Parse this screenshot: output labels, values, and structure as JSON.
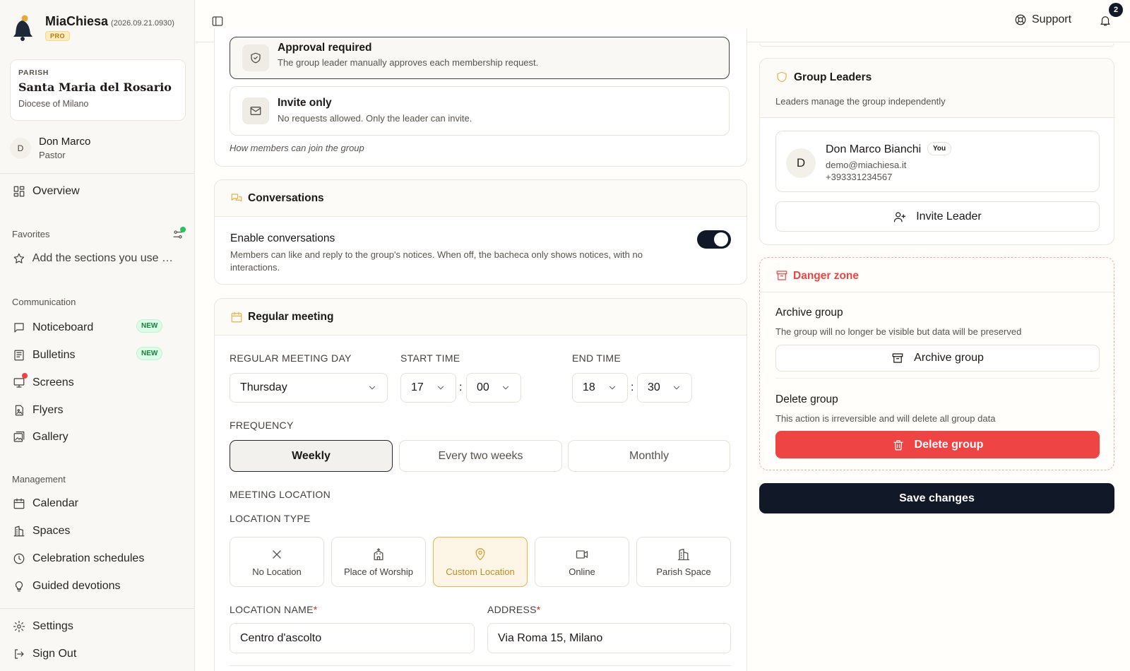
{
  "app": {
    "name": "MiaChiesa",
    "version": "(2026.09.21.0930)",
    "plan": "PRO"
  },
  "parish": {
    "label": "PARISH",
    "name": "Santa Maria del Rosario",
    "diocese": "Diocese of Milano"
  },
  "user": {
    "initial": "D",
    "name": "Don Marco",
    "role": "Pastor"
  },
  "sidebar": {
    "overview": "Overview",
    "favorites_label": "Favorites",
    "favorites_hint": "Add the sections you use most",
    "communication_label": "Communication",
    "communication": [
      {
        "label": "Noticeboard",
        "badge": "NEW"
      },
      {
        "label": "Bulletins",
        "badge": "NEW"
      },
      {
        "label": "Screens"
      },
      {
        "label": "Flyers"
      },
      {
        "label": "Gallery"
      }
    ],
    "management_label": "Management",
    "management": [
      {
        "label": "Calendar"
      },
      {
        "label": "Spaces"
      },
      {
        "label": "Celebration schedules"
      },
      {
        "label": "Guided devotions"
      }
    ],
    "settings": "Settings",
    "sign_out": "Sign Out"
  },
  "header": {
    "support": "Support",
    "notifications_count": "2"
  },
  "join_options": {
    "approval": {
      "title": "Approval required",
      "desc": "The group leader manually approves each membership request."
    },
    "invite": {
      "title": "Invite only",
      "desc": "No requests allowed. Only the leader can invite."
    },
    "hint": "How members can join the group"
  },
  "conversations": {
    "title": "Conversations",
    "enable_label": "Enable conversations",
    "enable_desc": "Members can like and reply to the group's notices. When off, the bacheca only shows notices, with no interactions.",
    "enabled": true
  },
  "meeting": {
    "title": "Regular meeting",
    "day_label": "REGULAR MEETING DAY",
    "day_value": "Thursday",
    "start_label": "START TIME",
    "start_hour": "17",
    "start_min": "00",
    "end_label": "END TIME",
    "end_hour": "18",
    "end_min": "30",
    "colon": ":",
    "frequency_label": "FREQUENCY",
    "frequency": [
      "Weekly",
      "Every two weeks",
      "Monthly"
    ],
    "frequency_selected": "Weekly",
    "location_section": "MEETING LOCATION",
    "location_type_label": "LOCATION TYPE",
    "location_types": [
      "No Location",
      "Place of Worship",
      "Custom Location",
      "Online",
      "Parish Space"
    ],
    "location_selected": "Custom Location",
    "location_name_label": "LOCATION NAME",
    "location_name_value": "Centro d'ascolto",
    "address_label": "ADDRESS",
    "address_value": "Via Roma 15, Milano",
    "required_mark": "*"
  },
  "leaders": {
    "title": "Group Leaders",
    "subtitle": "Leaders manage the group independently",
    "leader": {
      "initial": "D",
      "name": "Don Marco Bianchi",
      "tag": "You",
      "email": "demo@miachiesa.it",
      "phone": "+393331234567"
    },
    "invite_button": "Invite Leader"
  },
  "danger": {
    "title": "Danger zone",
    "archive_title": "Archive group",
    "archive_desc": "The group will no longer be visible but data will be preserved",
    "archive_button": "Archive group",
    "delete_title": "Delete group",
    "delete_desc": "This action is irreversible and will delete all group data",
    "delete_button": "Delete group"
  },
  "save_button": "Save changes",
  "colors": {
    "accent": "#e9b451",
    "danger": "#ef4444",
    "dark": "#111827",
    "new_badge": "#15803d"
  }
}
